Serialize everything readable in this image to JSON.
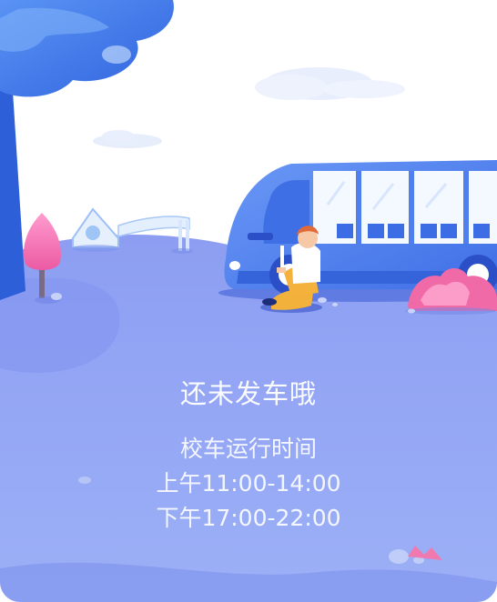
{
  "status": {
    "message": "还未发车哦"
  },
  "schedule": {
    "label": "校车运行时间",
    "morning": "上午11:00-14:00",
    "evening": "下午17:00-22:00"
  },
  "colors": {
    "ground": "#8c9ff2",
    "hill": "#8d9cf0",
    "bus": "#4f7ff0",
    "tree": "#3c6fe8",
    "cloud": "#e6edfb",
    "flower_pink": "#f06aa8"
  },
  "icons": {
    "illustration": "bus-waiting-illustration"
  }
}
